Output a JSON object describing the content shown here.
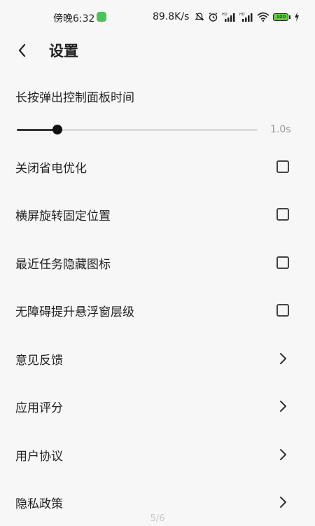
{
  "status_bar": {
    "time": "傍晚6:32",
    "network_speed": "89.8K/s",
    "battery": "100",
    "icons": [
      "app-notification-icon",
      "mute-icon",
      "alarm-icon",
      "signal-hd-1-icon",
      "signal-hd-2-icon",
      "wifi-icon",
      "battery-icon",
      "charging-icon"
    ]
  },
  "header": {
    "back_icon": "back-arrow-icon",
    "title": "设置"
  },
  "slider": {
    "label": "长按弹出控制面板时间",
    "value_text": "1.0s",
    "fraction": 0.17
  },
  "checkbox_items": [
    {
      "label": "关闭省电优化",
      "checked": false
    },
    {
      "label": "横屏旋转固定位置",
      "checked": false
    },
    {
      "label": "最近任务隐藏图标",
      "checked": false
    },
    {
      "label": "无障碍提升悬浮窗层级",
      "checked": false
    }
  ],
  "nav_items": [
    {
      "label": "意见反馈"
    },
    {
      "label": "应用评分"
    },
    {
      "label": "用户协议"
    },
    {
      "label": "隐私政策"
    }
  ],
  "page_indicator": "5/6"
}
